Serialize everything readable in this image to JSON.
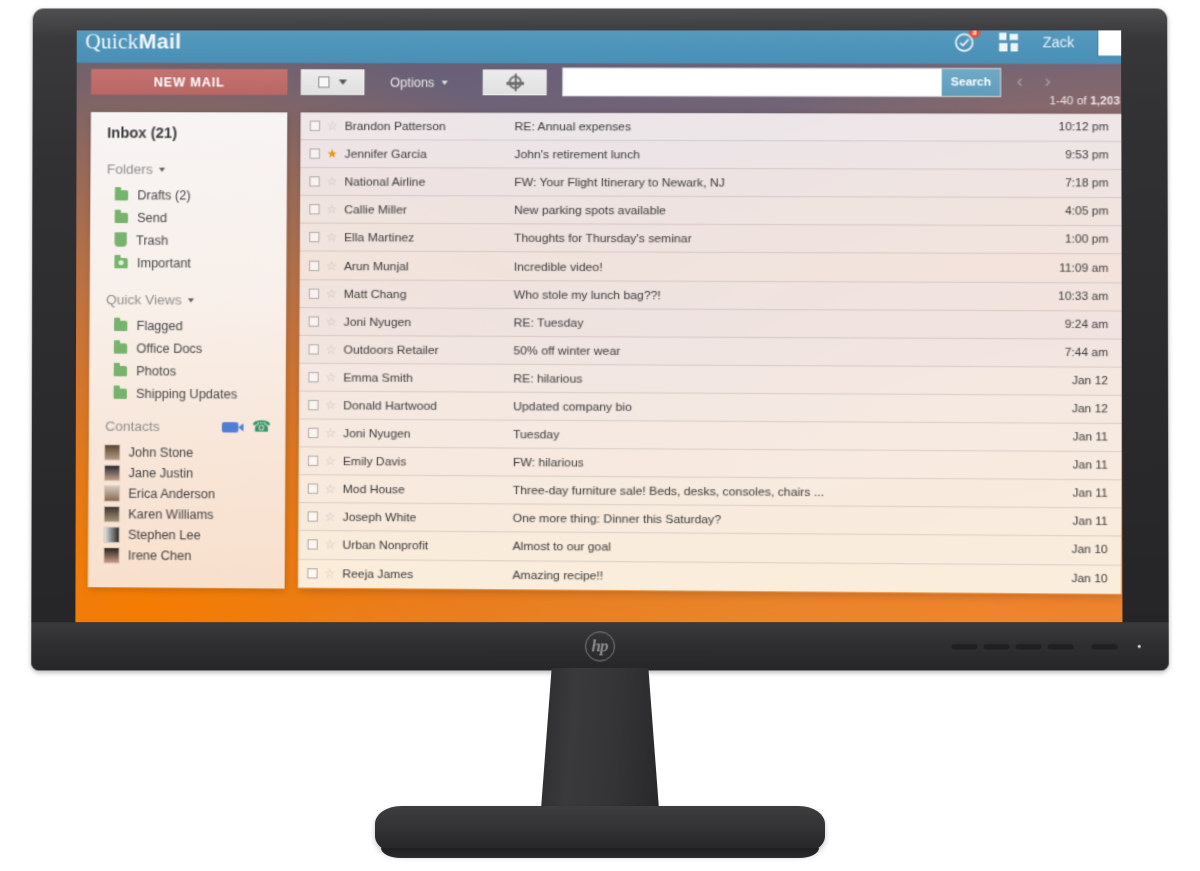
{
  "app": {
    "brand_primary": "Quick",
    "brand_secondary": "Mail",
    "accent_header": "#4f94ba",
    "accent_newmail": "#bd6b68",
    "accent_folder": "#76b36d",
    "accent_star": "#e8930d"
  },
  "header": {
    "notifications_icon": "clock-check-icon",
    "notifications_badge": "3",
    "apps_icon": "grid-apps-icon",
    "user_name": "Zack",
    "avatar_icon": "user-avatar"
  },
  "toolbar": {
    "new_mail_label": "NEW MAIL",
    "select_all_icon": "checkbox-icon",
    "select_caret_icon": "chevron-down-icon",
    "options_label": "Options",
    "settings_icon": "gear-icon",
    "search_value": "",
    "search_placeholder": "",
    "search_button_label": "Search",
    "prev_icon": "chevron-left-icon",
    "next_icon": "chevron-right-icon",
    "pagination_prefix": "1-40 of ",
    "pagination_total": "1,203"
  },
  "sidebar": {
    "inbox_label": "Inbox (21)",
    "folders_header": "Folders",
    "folders": [
      {
        "label": "Drafts (2)",
        "icon": "folder-icon"
      },
      {
        "label": "Send",
        "icon": "folder-icon"
      },
      {
        "label": "Trash",
        "icon": "trash-icon"
      },
      {
        "label": "Important",
        "icon": "folder-important-icon"
      }
    ],
    "quick_views_header": "Quick Views",
    "quick_views": [
      {
        "label": "Flagged",
        "icon": "folder-icon"
      },
      {
        "label": "Office Docs",
        "icon": "folder-icon"
      },
      {
        "label": "Photos",
        "icon": "folder-icon"
      },
      {
        "label": "Shipping Updates",
        "icon": "folder-icon"
      }
    ],
    "contacts_header": "Contacts",
    "contacts_video_icon": "video-camera-icon",
    "contacts_phone_icon": "phone-icon",
    "contacts": [
      {
        "name": "John Stone"
      },
      {
        "name": "Jane Justin"
      },
      {
        "name": "Erica Anderson"
      },
      {
        "name": "Karen Williams"
      },
      {
        "name": "Stephen Lee"
      },
      {
        "name": "Irene Chen"
      }
    ]
  },
  "maillist": {
    "rows": [
      {
        "sender": "Brandon Patterson",
        "subject": "RE: Annual expenses",
        "time": "10:12 pm",
        "starred": false
      },
      {
        "sender": "Jennifer Garcia",
        "subject": "John's retirement lunch",
        "time": "9:53 pm",
        "starred": true
      },
      {
        "sender": "National Airline",
        "subject": "FW: Your Flight Itinerary to Newark, NJ",
        "time": "7:18 pm",
        "starred": false
      },
      {
        "sender": "Callie Miller",
        "subject": "New parking spots available",
        "time": "4:05 pm",
        "starred": false
      },
      {
        "sender": "Ella Martinez",
        "subject": "Thoughts for Thursday's seminar",
        "time": "1:00 pm",
        "starred": false
      },
      {
        "sender": "Arun Munjal",
        "subject": "Incredible video!",
        "time": "11:09 am",
        "starred": false
      },
      {
        "sender": "Matt Chang",
        "subject": "Who stole my lunch bag??!",
        "time": "10:33 am",
        "starred": false
      },
      {
        "sender": "Joni Nyugen",
        "subject": "RE: Tuesday",
        "time": "9:24 am",
        "starred": false
      },
      {
        "sender": "Outdoors Retailer",
        "subject": "50% off winter wear",
        "time": "7:44 am",
        "starred": false
      },
      {
        "sender": "Emma Smith",
        "subject": "RE: hilarious",
        "time": "Jan 12",
        "starred": false
      },
      {
        "sender": "Donald Hartwood",
        "subject": "Updated company bio",
        "time": "Jan 12",
        "starred": false
      },
      {
        "sender": "Joni Nyugen",
        "subject": "Tuesday",
        "time": "Jan 11",
        "starred": false
      },
      {
        "sender": "Emily Davis",
        "subject": "FW: hilarious",
        "time": "Jan 11",
        "starred": false
      },
      {
        "sender": "Mod House",
        "subject": "Three-day furniture sale! Beds, desks, consoles, chairs ...",
        "time": "Jan 11",
        "starred": false
      },
      {
        "sender": "Joseph White",
        "subject": "One more thing: Dinner this Saturday?",
        "time": "Jan 11",
        "starred": false
      },
      {
        "sender": "Urban Nonprofit",
        "subject": "Almost to our goal",
        "time": "Jan 10",
        "starred": false
      },
      {
        "sender": "Reeja James",
        "subject": "Amazing recipe!!",
        "time": "Jan 10",
        "starred": false
      }
    ]
  },
  "monitor": {
    "brand_logo": "hp",
    "osd_buttons": [
      "menu-button",
      "minus-button",
      "plus-button",
      "ok-button"
    ],
    "power_button": "power-button",
    "power_led": "power-led"
  }
}
